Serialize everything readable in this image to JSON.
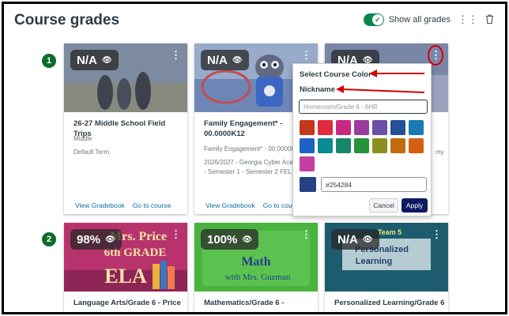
{
  "header": {
    "title": "Course grades",
    "toggle_label": "Show all grades",
    "icons": [
      "toggle-check-icon",
      "drag-handle-icon",
      "trash-icon"
    ]
  },
  "markers": [
    "1",
    "2"
  ],
  "cards": [
    {
      "grade": "N/A",
      "title": "26-27 Middle School Field Trips",
      "sub1": "Middle",
      "sub2": "Default Term",
      "link_gradebook": "View Gradebook",
      "link_course": "Go to course",
      "hero_color": "#6f7d8f"
    },
    {
      "grade": "N/A",
      "title": "Family Engagement* - 00.0000K12",
      "sub1": "Family Engagement* - 00.0000K",
      "sub2": "2026/2027 - Georgia Cyber Aca",
      "sub3": "- Semester 1 - Semester 2 FEL",
      "link_gradebook": "View Gradebook",
      "link_course": "Go to course",
      "hero_color": "#7c8fb0"
    },
    {
      "grade": "N/A",
      "title": "",
      "sub_right": "my",
      "hero_color": "#7a86a8"
    },
    {
      "grade": "98%",
      "title": "Language Arts/Grade 6 - Price",
      "hero_text1": "Mrs. Price",
      "hero_text2": "6th GRADE",
      "hero_text3": "ELA",
      "hero_color": "#b8336e"
    },
    {
      "grade": "100%",
      "title": "Mathematics/Grade 6 -",
      "hero_text1": "Math",
      "hero_text2": "with Mrs. Guzman",
      "hero_color": "#49b33f"
    },
    {
      "grade": "N/A",
      "title": "Personalized Learning/Grade 6 -",
      "hero_text1": "Personalized",
      "hero_text2": "Learning",
      "hero_text3": "Team 5",
      "hero_color": "#1d5c6e"
    }
  ],
  "popover": {
    "color_label": "Select Course Color",
    "nickname_label": "Nickname",
    "nickname_placeholder": "Homeroom/Grade 6 - 6HR",
    "swatches": [
      "#c4381c",
      "#e22b3b",
      "#c8287f",
      "#9b3c9b",
      "#6a4fa6",
      "#244f99",
      "#1a7bb5",
      "#1d62c4",
      "#0b8a95",
      "#17876b",
      "#27913c",
      "#8c8f20",
      "#c16b0f",
      "#d85e12",
      "#c33fa0"
    ],
    "selected_color": "#254284",
    "hex_value": "#254284",
    "cancel_label": "Cancel",
    "apply_label": "Apply"
  },
  "annotation_color": "#d40000"
}
